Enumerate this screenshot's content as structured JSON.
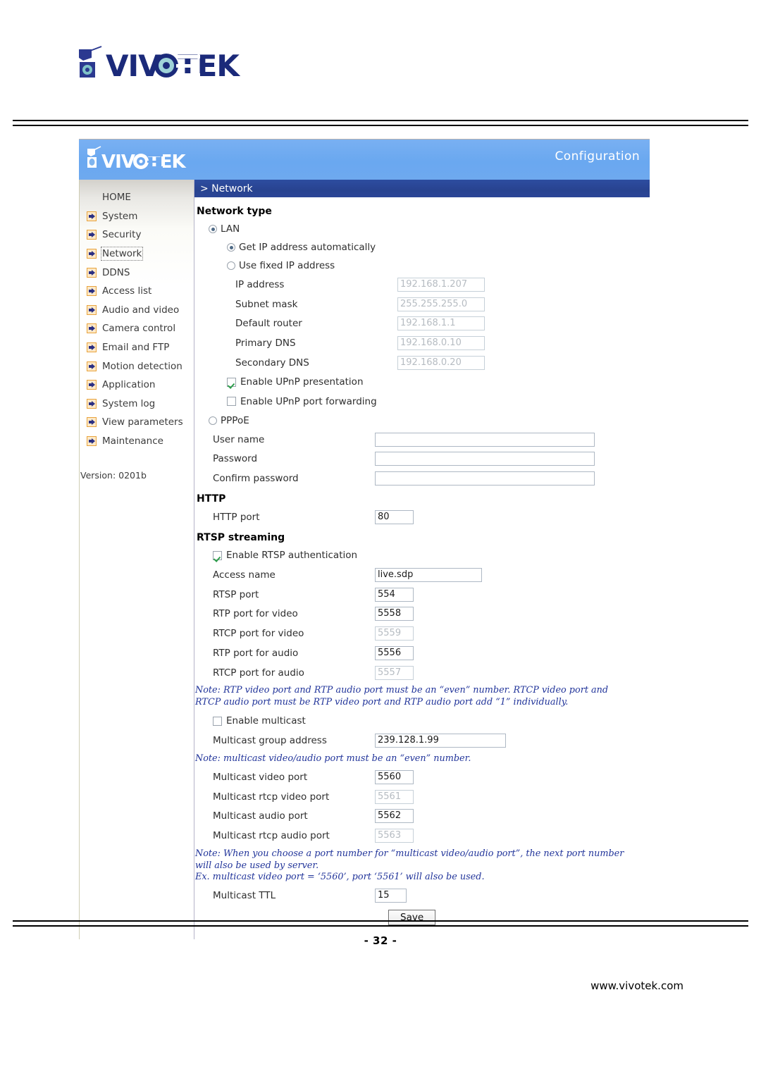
{
  "document": {
    "brand": "VIVOTEK",
    "page_number": "- 32 -",
    "website": "www.vivotek.com"
  },
  "camera_ui": {
    "header": {
      "logo_text": "VIVOTEK",
      "title": "Configuration"
    },
    "breadcrumb": "> Network",
    "sidebar": {
      "items": [
        {
          "label": "HOME",
          "has_icon": false,
          "selected": false
        },
        {
          "label": "System",
          "has_icon": true,
          "selected": false
        },
        {
          "label": "Security",
          "has_icon": true,
          "selected": false
        },
        {
          "label": "Network",
          "has_icon": true,
          "selected": true
        },
        {
          "label": "DDNS",
          "has_icon": true,
          "selected": false
        },
        {
          "label": "Access list",
          "has_icon": true,
          "selected": false
        },
        {
          "label": "Audio and video",
          "has_icon": true,
          "selected": false
        },
        {
          "label": "Camera control",
          "has_icon": true,
          "selected": false
        },
        {
          "label": "Email and FTP",
          "has_icon": true,
          "selected": false
        },
        {
          "label": "Motion detection",
          "has_icon": true,
          "selected": false
        },
        {
          "label": "Application",
          "has_icon": true,
          "selected": false
        },
        {
          "label": "System log",
          "has_icon": true,
          "selected": false
        },
        {
          "label": "View parameters",
          "has_icon": true,
          "selected": false
        },
        {
          "label": "Maintenance",
          "has_icon": true,
          "selected": false
        }
      ],
      "version": "Version: 0201b"
    },
    "network_type": {
      "title": "Network type",
      "lan_label": "LAN",
      "lan_selected": true,
      "dhcp_label": "Get IP address automatically",
      "dhcp_selected": true,
      "fixed_label": "Use fixed IP address",
      "fixed_selected": false,
      "fields": [
        {
          "label": "IP address",
          "value": "192.168.1.207",
          "disabled": true
        },
        {
          "label": "Subnet mask",
          "value": "255.255.255.0",
          "disabled": true
        },
        {
          "label": "Default router",
          "value": "192.168.1.1",
          "disabled": true
        },
        {
          "label": "Primary DNS",
          "value": "192.168.0.10",
          "disabled": true
        },
        {
          "label": "Secondary DNS",
          "value": "192.168.0.20",
          "disabled": true
        }
      ],
      "upnp_presentation_label": "Enable UPnP presentation",
      "upnp_presentation_checked": true,
      "upnp_forwarding_label": "Enable UPnP port forwarding",
      "upnp_forwarding_checked": false,
      "pppoe_label": "PPPoE",
      "pppoe_selected": false,
      "pppoe_fields": [
        {
          "label": "User name",
          "value": ""
        },
        {
          "label": "Password",
          "value": ""
        },
        {
          "label": "Confirm password",
          "value": ""
        }
      ]
    },
    "http": {
      "title": "HTTP",
      "port_label": "HTTP port",
      "port_value": "80"
    },
    "rtsp": {
      "title": "RTSP streaming",
      "auth_label": "Enable RTSP authentication",
      "auth_checked": true,
      "access_name_label": "Access name",
      "access_name_value": "live.sdp",
      "ports": [
        {
          "label": "RTSP port",
          "value": "554",
          "disabled": false
        },
        {
          "label": "RTP port for video",
          "value": "5558",
          "disabled": false
        },
        {
          "label": "RTCP port for video",
          "value": "5559",
          "disabled": true
        },
        {
          "label": "RTP port for audio",
          "value": "5556",
          "disabled": false
        },
        {
          "label": "RTCP port for audio",
          "value": "5557",
          "disabled": true
        }
      ],
      "note_rtp": "Note: RTP video port and RTP audio port must be an “even” number. RTCP video port and RTCP audio port must be RTP video port and RTP audio port add “1” individually.",
      "multicast_enable_label": "Enable multicast",
      "multicast_enable_checked": false,
      "multicast_group_label": "Multicast group address",
      "multicast_group_value": "239.128.1.99",
      "note_multicast_even": "Note: multicast video/audio port must be an “even” number.",
      "multicast_ports": [
        {
          "label": "Multicast video port",
          "value": "5560",
          "disabled": false
        },
        {
          "label": "Multicast rtcp video port",
          "value": "5561",
          "disabled": true
        },
        {
          "label": "Multicast audio port",
          "value": "5562",
          "disabled": false
        },
        {
          "label": "Multicast rtcp audio port",
          "value": "5563",
          "disabled": true
        }
      ],
      "note_next_port": "Note: When you choose a port number for “multicast video/audio port”, the next port number will also be used by server.\nEx. multicast video port = ‘5560’, port ‘5561’ will also be used.",
      "ttl_label": "Multicast TTL",
      "ttl_value": "15"
    },
    "save_label": "Save"
  },
  "colors": {
    "header_blue": "#6FACF2",
    "breadcrumb_blue": "#2B4596",
    "note_blue": "#21349A",
    "icon_orange": "#E8A33D",
    "check_green": "#2E9E4B"
  }
}
